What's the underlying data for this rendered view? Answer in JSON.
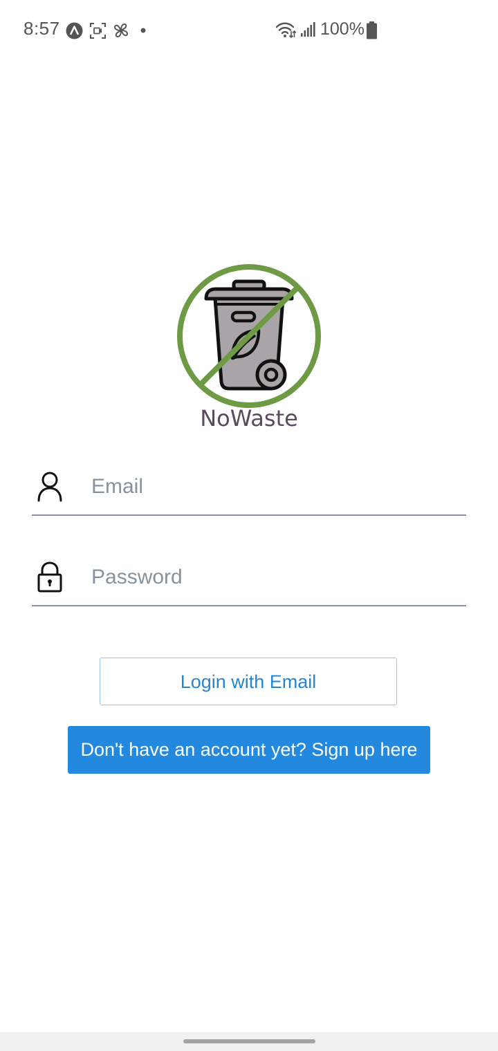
{
  "status_bar": {
    "time": "8:57",
    "battery_percent": "100%",
    "icons": [
      "app-notification-icon",
      "screen-record-icon",
      "pinwheel-icon",
      "dot-icon",
      "wifi-icon",
      "signal-icon",
      "battery-icon"
    ]
  },
  "app": {
    "name": "NoWaste",
    "logo_icon": "no-trash-bin-icon",
    "colors": {
      "logo_ring": "#6f9a45",
      "bin_fill": "#a8a4a8",
      "name_text": "#5a4a5e"
    }
  },
  "form": {
    "email": {
      "placeholder": "Email",
      "value": "",
      "icon": "user-icon"
    },
    "password": {
      "placeholder": "Password",
      "value": "",
      "icon": "lock-icon"
    }
  },
  "buttons": {
    "login_label": "Login with Email",
    "signup_label": "Don't have an account yet? Sign up here"
  },
  "theme": {
    "primary": "#2389df",
    "outline": "#9cc3e6",
    "underline": "#8a949e"
  }
}
